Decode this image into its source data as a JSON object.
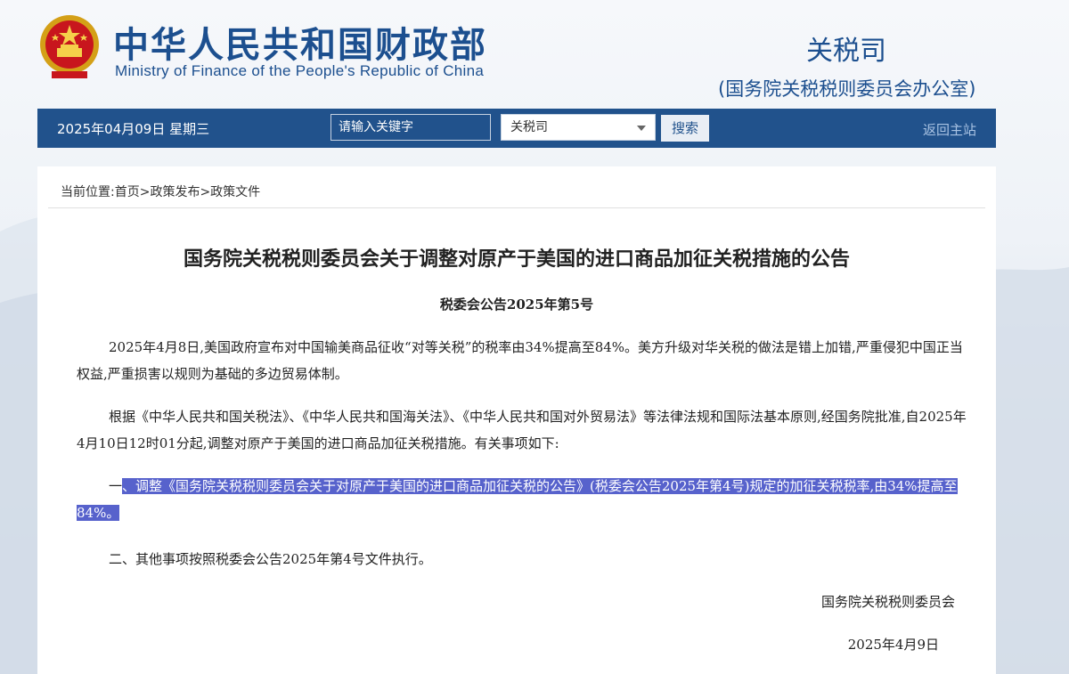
{
  "header": {
    "org_name_cn": "中华人民共和国财政部",
    "org_name_en": "Ministry of Finance of the People's Republic of China",
    "dept_title": "关税司",
    "dept_subtitle": "(国务院关税税则委员会办公室)",
    "emblem_icon": "national-emblem-icon"
  },
  "navbar": {
    "date": "2025年04月09日  星期三",
    "search_placeholder": "请输入关键字",
    "select_value": "关税司",
    "search_button": "搜索",
    "home_link": "返回主站"
  },
  "breadcrumb": {
    "label": "当前位置:",
    "items": [
      "首页",
      ">政策发布",
      ">政策文件"
    ]
  },
  "document": {
    "title": "国务院关税税则委员会关于调整对原产于美国的进口商品加征关税措施的公告",
    "number": "税委会公告2025年第5号",
    "para1": "2025年4月8日,美国政府宣布对中国输美商品征收“对等关税”的税率由34%提高至84%。美方升级对华关税的做法是错上加错,严重侵犯中国正当权益,严重损害以规则为基础的多边贸易体制。",
    "para2": "根据《中华人民共和国关税法》、《中华人民共和国海关法》、《中华人民共和国对外贸易法》等法律法规和国际法基本原则,经国务院批准,自2025年4月10日12时01分起,调整对原产于美国的进口商品加征关税措施。有关事项如下:",
    "para3_prefix": "一",
    "para3_highlight": "、调整《国务院关税税则委员会关于对原产于美国的进口商品加征关税的公告》(税委会公告2025年第4号)规定的加征关税税率,由34%提高至84%。",
    "para4": "二、其他事项按照税委会公告2025年第4号文件执行。",
    "signer": "国务院关税税则委员会",
    "sign_date": "2025年4月9日"
  },
  "colors": {
    "brand_blue": "#1c4f8f",
    "navbar_bg": "#21528c",
    "selection_highlight": "#5762cc"
  }
}
